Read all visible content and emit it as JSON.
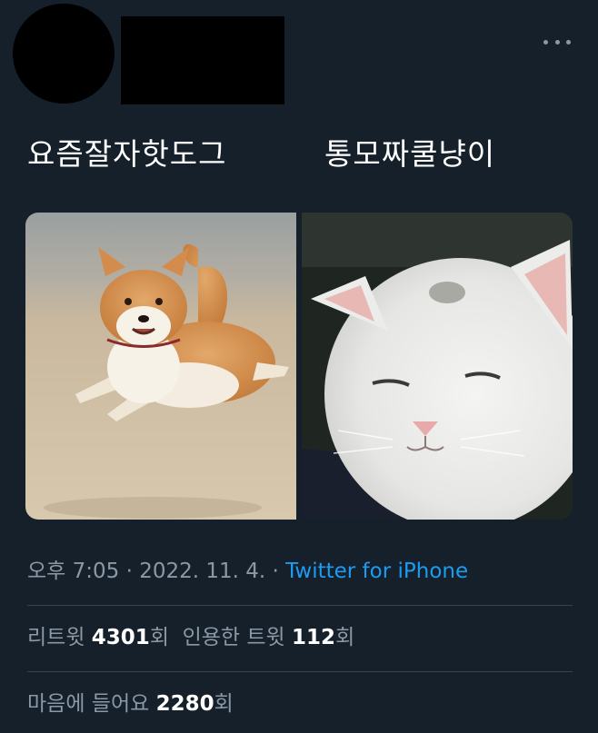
{
  "header": {
    "avatar_icon": "redacted-avatar",
    "more_icon": "more-horizontal-icon"
  },
  "tweet": {
    "text_left": "요즘잘자핫도그",
    "text_right": "통모짜쿨냥이",
    "images": [
      {
        "alt": "shiba-inu-jumping-icon"
      },
      {
        "alt": "white-kitten-icon"
      }
    ]
  },
  "meta": {
    "time": "오후 7:05",
    "sep1": " · ",
    "date": "2022. 11. 4.",
    "sep2": " · ",
    "source": "Twitter for iPhone"
  },
  "stats": {
    "retweet_label": "리트윗 ",
    "retweet_count": "4301",
    "retweet_unit": "회",
    "quote_label": "인용한 트윗 ",
    "quote_count": "112",
    "quote_unit": "회",
    "like_label": "마음에 들어요 ",
    "like_count": "2280",
    "like_unit": "회"
  },
  "colors": {
    "background": "#15202b",
    "muted": "#8b98a5",
    "link": "#1d9bf0",
    "divider": "#38444d"
  }
}
